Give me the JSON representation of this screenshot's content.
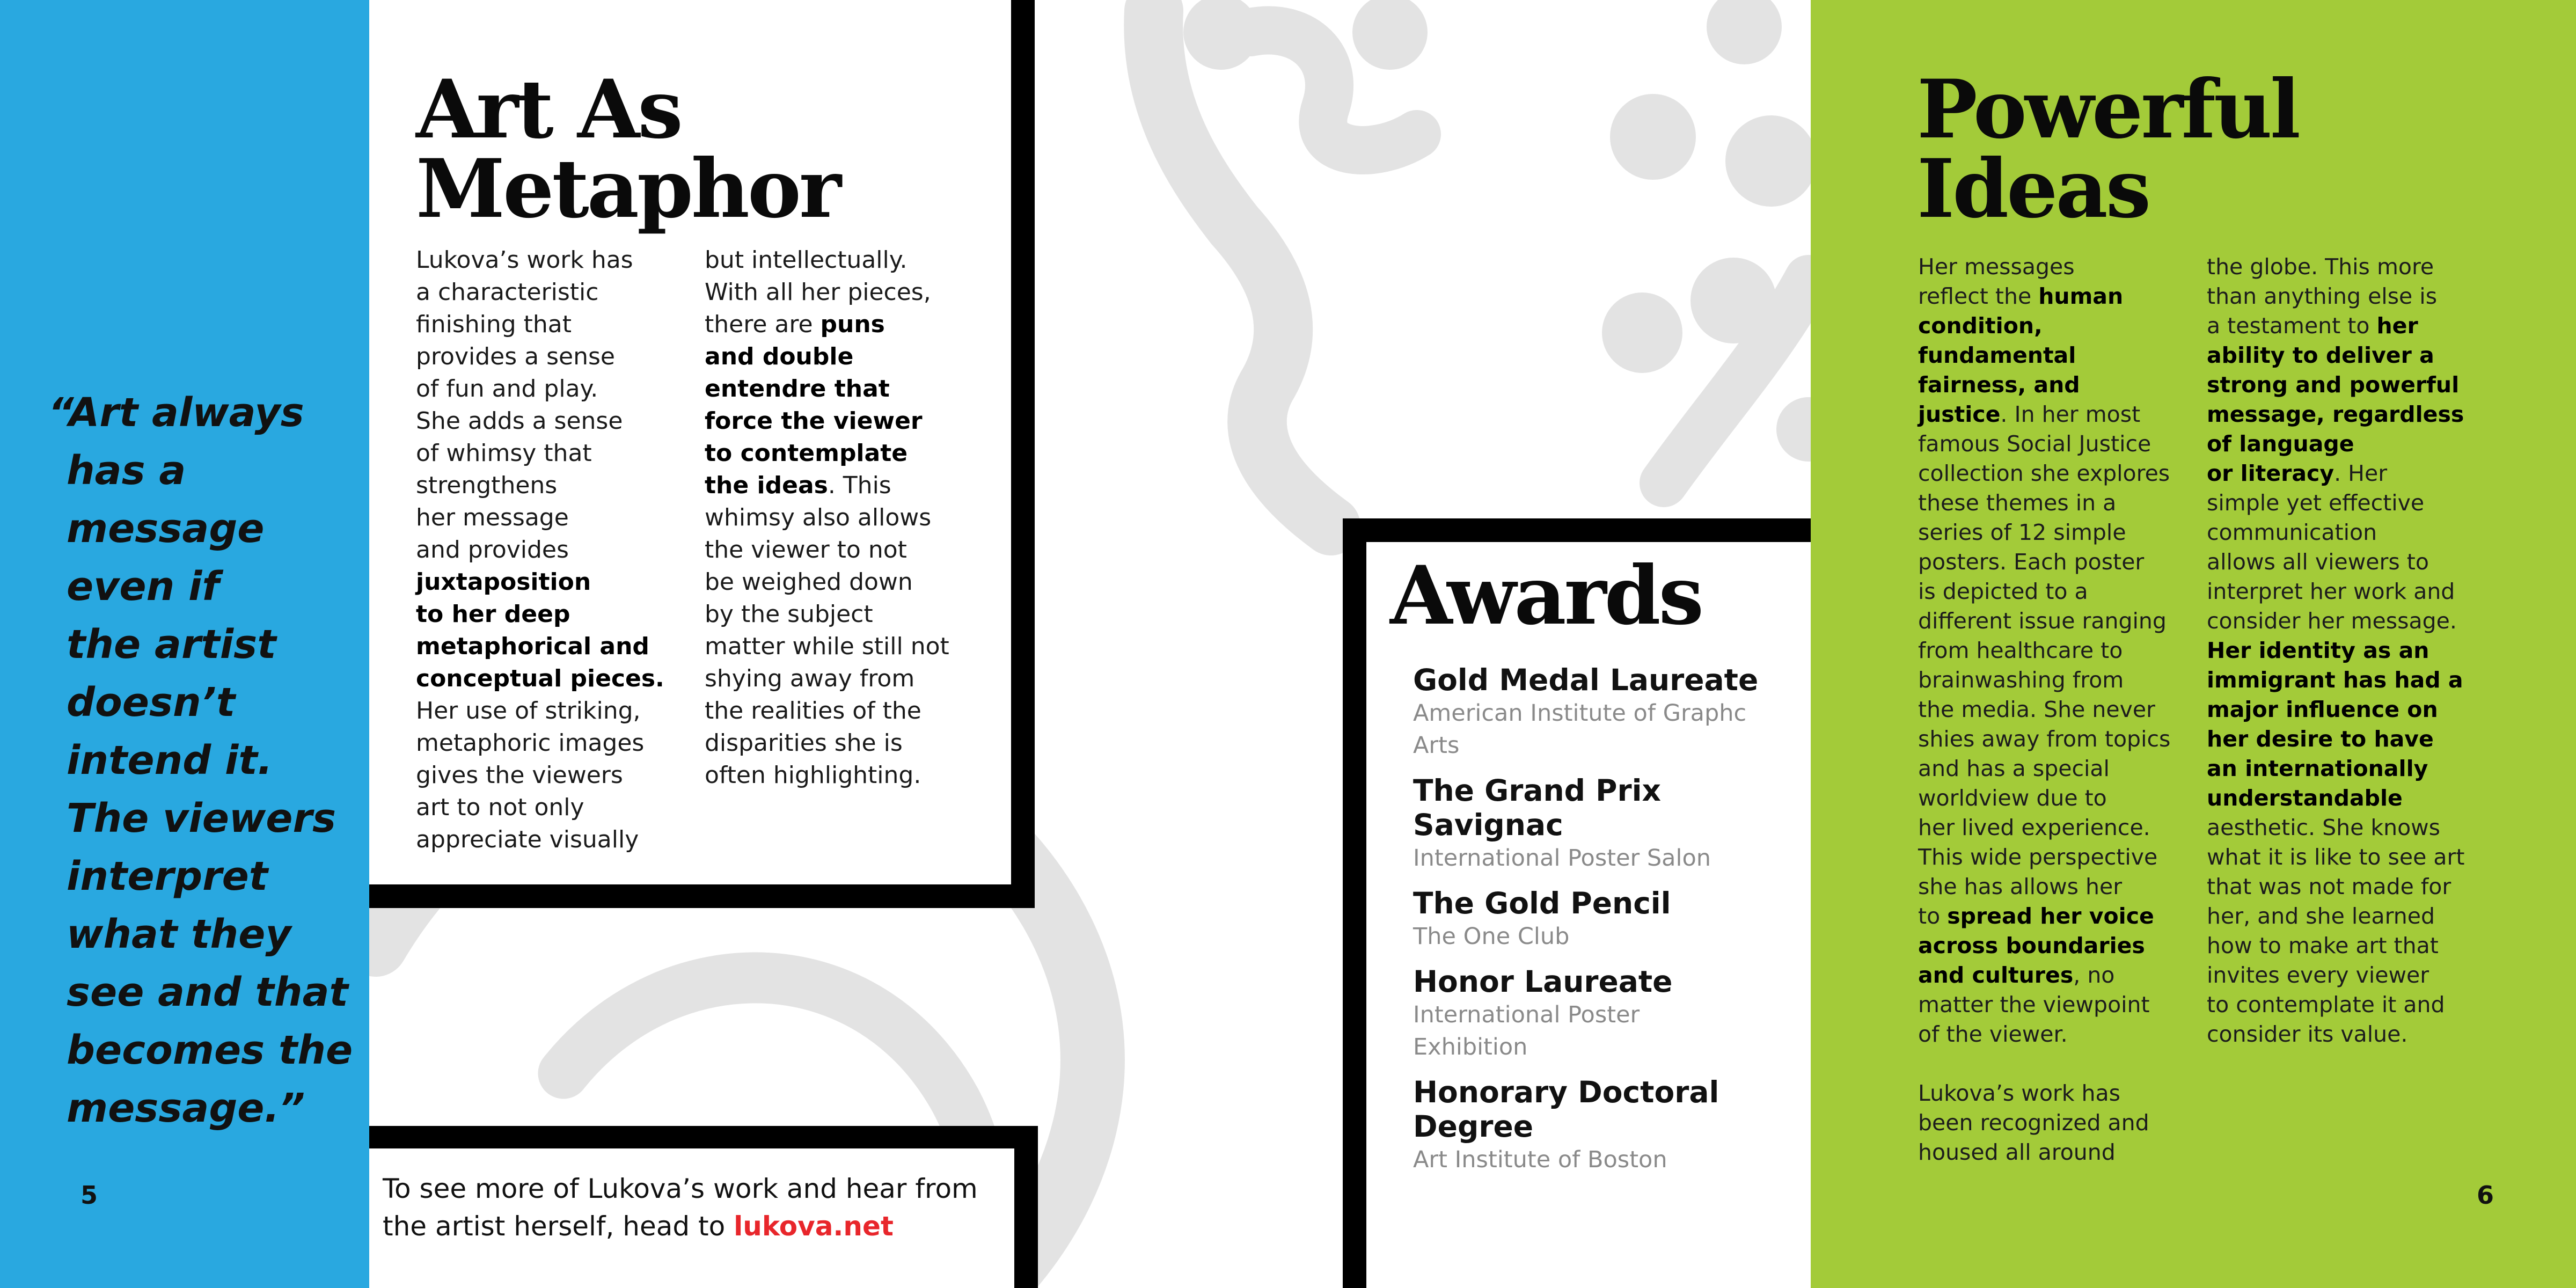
{
  "spread": {
    "left_page_number": "5",
    "right_page_number": "6"
  },
  "quote": {
    "lines": [
      "“Art always",
      "has a",
      "message",
      "even if",
      "the artist",
      "doesn’t",
      "intend it.",
      "The viewers",
      "interpret",
      "what they",
      "see and that",
      "becomes the",
      "message.”"
    ]
  },
  "metaphor": {
    "title_lines": [
      "Art As",
      "Metaphor"
    ],
    "col1": [
      "Lukova’s work has",
      "a characteristic",
      "finishing that",
      "provides a sense",
      "of fun and play.",
      "She adds a sense",
      "of whimsy that",
      "strengthens",
      "her message",
      "and provides",
      "juxtaposition",
      "to her deep",
      "metaphorical and",
      "conceptual pieces.",
      "Her use of striking,",
      "metaphoric images",
      "gives the viewers",
      "art to not only",
      "appreciate visually"
    ],
    "col2": [
      "but intellectually.",
      "With all her pieces,",
      "there are ",
      "puns",
      "and double",
      "entendre that",
      "force the viewer",
      "to contemplate",
      "the ideas",
      ". This",
      "whimsy also allows",
      "the viewer to not",
      "be weighed down",
      "by the subject",
      "matter while still not",
      "shying away from",
      "the realities of the",
      "disparities she is",
      "often highlighting."
    ]
  },
  "cta": {
    "line1": "To see more of Lukova’s work and hear from",
    "line2_prefix": "the artist herself, head to ",
    "link": "lukova.net"
  },
  "awards": {
    "title": "Awards",
    "items": [
      {
        "title": [
          "Gold Medal Laureate"
        ],
        "org": [
          "American Institute of Graphc",
          "Arts"
        ]
      },
      {
        "title": [
          "The Grand Prix",
          "Savignac"
        ],
        "org": [
          "International Poster Salon"
        ]
      },
      {
        "title": [
          "The Gold Pencil"
        ],
        "org": [
          "The One Club"
        ]
      },
      {
        "title": [
          "Honor Laureate"
        ],
        "org": [
          "International Poster",
          "Exhibition"
        ]
      },
      {
        "title": [
          "Honorary Doctoral",
          "Degree"
        ],
        "org": [
          "Art Institute of Boston"
        ]
      }
    ]
  },
  "ideas": {
    "title_lines": [
      "Powerful",
      "Ideas"
    ],
    "col1": [
      "Her messages",
      "reflect the ",
      "human",
      "condition,",
      "fundamental",
      "fairness, and",
      "justice",
      ". In her most",
      "famous Social Justice",
      "collection she explores",
      "these themes in a",
      "series of 12 simple",
      "posters. Each poster",
      "is depicted to a",
      "different issue ranging",
      "from healthcare to",
      "brainwashing from",
      "the media. She never",
      "shies away from topics",
      "and has a special",
      "worldview due to",
      "her lived experience.",
      "This wide perspective",
      "she has allows her",
      "to ",
      "spread her voice",
      "across boundaries",
      "and cultures",
      ", no",
      "matter the viewpoint",
      "of the viewer.",
      "Lukova’s work has",
      "been recognized and",
      "housed all around"
    ],
    "col2": [
      "the globe. This more",
      "than anything else is",
      "a testament to ",
      "her",
      "ability to deliver a",
      "strong and powerful",
      "message, regardless",
      "of language",
      "or literacy",
      ". Her",
      "simple yet effective",
      "communication",
      "allows all viewers to",
      "interpret her work and",
      "consider her message.",
      "Her identity as an",
      "immigrant has had a",
      "major influence on",
      "her desire to have",
      "an internationally",
      "understandable",
      " aesthetic. She knows",
      "what it is like to see art",
      "that was not made for",
      "her, and she learned",
      "how to make art that",
      "invites every viewer",
      "to contemplate it and",
      "consider its value."
    ]
  },
  "colors": {
    "blue": "#29a8e0",
    "green": "#a3cb39",
    "link_red": "#e8262b",
    "art_gray": "#e3e3e3"
  }
}
